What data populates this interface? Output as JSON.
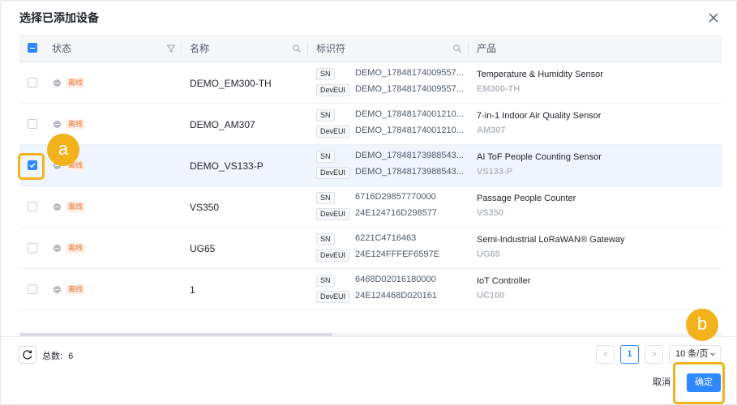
{
  "dialog": {
    "title": "选择已添加设备"
  },
  "table": {
    "columns": {
      "status": "状态",
      "name": "名称",
      "identifier": "标识符",
      "product": "产品"
    },
    "rows": [
      {
        "checked": false,
        "status": "离线",
        "name": "DEMO_EM300-TH",
        "sn_tag": "SN",
        "sn": "DEMO_17848174009557...",
        "deveui_tag": "DevEUI",
        "deveui": "DEMO_17848174009557...",
        "product_name": "Temperature & Humidity Sensor",
        "product_model": "EM300-TH"
      },
      {
        "checked": false,
        "status": "离线",
        "name": "DEMO_AM307",
        "sn_tag": "SN",
        "sn": "DEMO_17848174001210...",
        "deveui_tag": "DevEUI",
        "deveui": "DEMO_17848174001210...",
        "product_name": "7-in-1 Indoor Air Quality Sensor",
        "product_model": "AM307"
      },
      {
        "checked": true,
        "status": "离线",
        "name": "DEMO_VS133-P",
        "sn_tag": "SN",
        "sn": "DEMO_17848173988543...",
        "deveui_tag": "DevEUI",
        "deveui": "DEMO_17848173988543...",
        "product_name": "AI ToF People Counting Sensor",
        "product_model": "VS133-P"
      },
      {
        "checked": false,
        "status": "离线",
        "name": "VS350",
        "sn_tag": "SN",
        "sn": "6716D29857770000",
        "deveui_tag": "DevEUI",
        "deveui": "24E124716D298577",
        "product_name": "Passage People Counter",
        "product_model": "VS350"
      },
      {
        "checked": false,
        "status": "离线",
        "name": "UG65",
        "sn_tag": "SN",
        "sn": "6221C4716463",
        "deveui_tag": "DevEUI",
        "deveui": "24E124FFFEF6597E",
        "product_name": "Semi-Industrial LoRaWAN® Gateway",
        "product_model": "UG65"
      },
      {
        "checked": false,
        "status": "离线",
        "name": "1",
        "sn_tag": "SN",
        "sn": "6468D02016180000",
        "deveui_tag": "DevEUI",
        "deveui": "24E124468D020161",
        "product_name": "IoT Controller",
        "product_model": "UC100"
      }
    ]
  },
  "footer": {
    "total_label": "总数:",
    "total_count": "6",
    "current_page": "1",
    "page_size": "10 条/页",
    "cancel_label": "取消",
    "ok_label": "确定"
  },
  "annotations": {
    "callout_a": "a",
    "callout_b": "b"
  },
  "colors": {
    "primary": "#2f88ff",
    "offline_badge": "#ef6d2c",
    "highlight": "#f2b21c"
  }
}
